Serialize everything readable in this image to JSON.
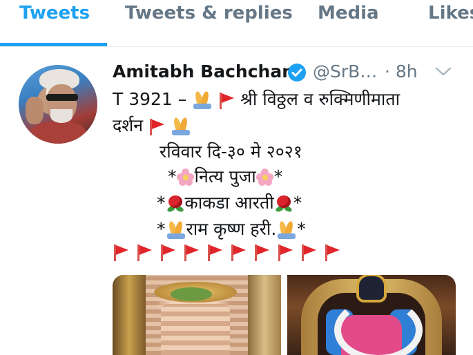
{
  "tabs": [
    {
      "label": "Tweets",
      "active": true
    },
    {
      "label": "Tweets & replies",
      "active": false
    },
    {
      "label": "Media",
      "active": false
    },
    {
      "label": "Likes",
      "active": false
    }
  ],
  "tweet": {
    "author_name": "Amitabh Bachchan",
    "handle": "@SrB…",
    "time": "· 8h",
    "lines": {
      "l1_prefix": "T 3921 – ",
      "l1_text": "श्री विठ्ठल व रुक्मिणीमाता",
      "l2_text": "दर्शन",
      "l3_text": "रविवार दि-३० मे २०२१",
      "l4_text": "नित्य पुजा",
      "l5_text": "काकडा आरती",
      "l6_text": "राम कृष्ण हरी.",
      "star": "*"
    },
    "flag_count": 10,
    "media": [
      {
        "alt": "temple-idol-image-1"
      },
      {
        "alt": "temple-idol-image-2"
      }
    ]
  },
  "colors": {
    "accent": "#1da1f2",
    "secondary_text": "#657786",
    "primary_text": "#14171a"
  }
}
